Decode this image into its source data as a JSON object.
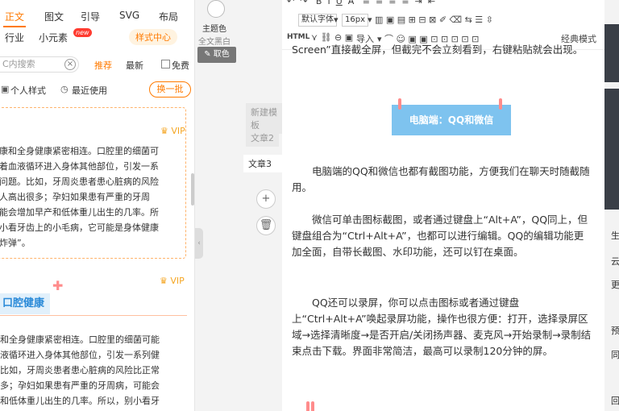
{
  "categories_row1": [
    "正文",
    "图文",
    "引导",
    "SVG",
    "布局"
  ],
  "categories_row2": [
    "行业",
    "小元素"
  ],
  "new_badge": "new",
  "style_center": "样式中心",
  "search": {
    "placeholder": "C内搜索",
    "clear": "×"
  },
  "filters": {
    "recommend": "推荐",
    "latest": "最新",
    "free": "免费"
  },
  "personal_style": "个人样式",
  "recent_used": "最近使用",
  "change_batch": "换一批",
  "vip_label": "VIP",
  "card1_lines": [
    "康和全身健康紧密相连。口腔里的细菌可",
    "着血液循环进入身体其他部位，引发一系",
    "问题。比如，牙周炎患者患心脏病的风险",
    "人高出很多；孕妇如果患有严重的牙周",
    "能会增加早产和低体重儿出生的几率。所",
    "小看牙齿上的小毛病，它可能是身体健康",
    "炸弹”。"
  ],
  "health_title": "口腔健康",
  "text2_lines": [
    "和全身健康紧密相连。口腔里的细菌可能",
    "液循环进入身体其他部位，引发一系列健",
    "比如，牙周炎患者患心脏病的风险比正常",
    "多；孕妇如果患有严重的牙周病，可能会",
    "和低体重儿出生的几率。所以，别小看牙"
  ],
  "middle": {
    "theme_color": "主题色",
    "full_bw": "全文黑白",
    "pick_color": "取色",
    "articles": [
      "新建模板",
      "文章2",
      "文章3"
    ],
    "collapse": "‹"
  },
  "toolbar": {
    "font_name": "默认字体",
    "font_size": "16px",
    "html": "HTML",
    "import": "导入",
    "classic_mode": "经典模式"
  },
  "editor": {
    "intro": "Screen”直接截全屏，但截完不会立刻看到，右键粘贴就会出现。",
    "banner": "电脑端：QQ和微信",
    "para1": "电脑端的QQ和微信也都有截图功能，方便我们在聊天时随截随用。",
    "para2": "微信可单击图标截图，或者通过键盘上“Alt+A”，QQ同上，但键盘组合为“Ctrl+Alt+A”，也都可以进行编辑。QQ的编辑功能更加全面，自带长截图、水印功能，还可以钉在桌面。",
    "para3": "QQ还可以录屏，你可以点击图标或者通过键盘上“Ctrl+Alt+A”唤起录屏功能，操作也很方便：打开，选择录屏区域→选择清晰度→是否开启/关闭扬声器、麦克风→开始录制→录制结束点击下载。界面非常简洁，最高可以录制120分钟的屏。"
  },
  "right_chars": [
    "生",
    "云",
    "更",
    "预",
    "同",
    "回"
  ],
  "colors": {
    "accent": "#ff7a00",
    "banner": "#7ec3ef",
    "title_blue": "#2a8ad8"
  }
}
